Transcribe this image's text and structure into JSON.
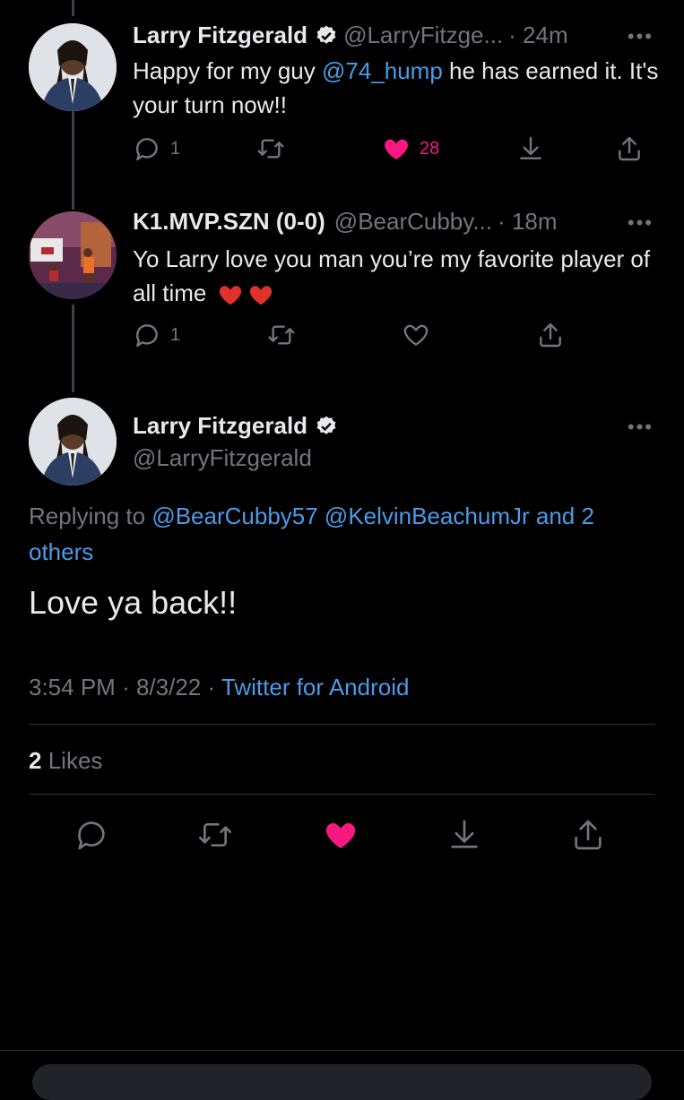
{
  "tweets": [
    {
      "name": "Larry Fitzgerald",
      "verified": true,
      "handle": "@LarryFitzge...",
      "time": "· 24m",
      "text_before": "Happy for my guy ",
      "mention": "@74_hump",
      "text_after": " he has earned it. It's your turn now!!",
      "replies": "1",
      "likes": "28",
      "liked": true
    },
    {
      "name": "K1.MVP.SZN (0-0)",
      "verified": false,
      "handle": "@BearCubby...",
      "time": "· 18m",
      "text": "Yo Larry love you man you’re my favorite player of all time",
      "emoji": "❤️❤️",
      "replies": "1",
      "liked": false
    }
  ],
  "main": {
    "name": "Larry Fitzgerald",
    "handle": "@LarryFitzgerald",
    "replying_label": "Replying to ",
    "replying_users": "@BearCubby57 @KelvinBeachumJr and 2 others",
    "text": "Love ya back!!",
    "time": "3:54 PM",
    "date": "8/3/22",
    "source": "Twitter for Android",
    "likes_count": "2",
    "likes_label": "Likes"
  },
  "colors": {
    "accent": "#4c9be8",
    "like": "#f91880",
    "background": "#000000",
    "muted": "#71767b"
  },
  "icons": [
    "reply-icon",
    "retweet-icon",
    "like-icon",
    "bookmark-icon",
    "share-icon",
    "more-icon",
    "verified-badge-icon"
  ]
}
